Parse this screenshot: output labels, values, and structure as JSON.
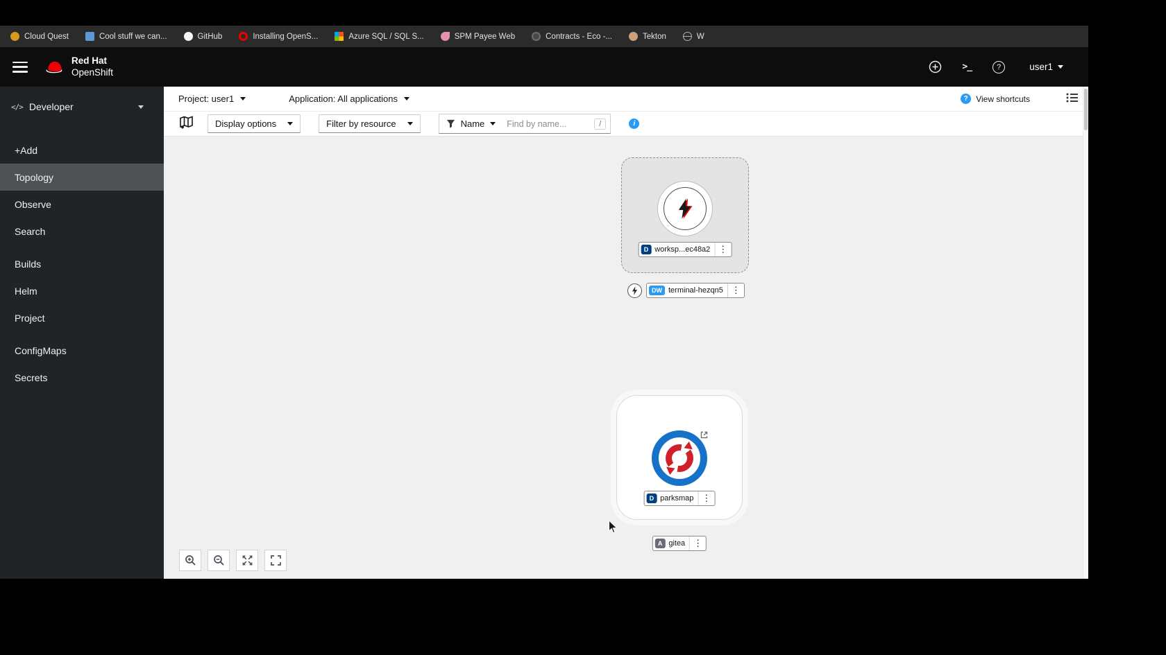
{
  "browser": {
    "bookmarks": [
      {
        "label": "Cloud Quest"
      },
      {
        "label": "Cool stuff we can..."
      },
      {
        "label": "GitHub"
      },
      {
        "label": "Installing OpenS..."
      },
      {
        "label": "Azure SQL / SQL S..."
      },
      {
        "label": "SPM Payee Web"
      },
      {
        "label": "Contracts - Eco -..."
      },
      {
        "label": "Tekton"
      },
      {
        "label": "W"
      }
    ]
  },
  "masthead": {
    "brand_line1": "Red Hat",
    "brand_line2": "OpenShift",
    "username": "user1"
  },
  "sidebar": {
    "perspective": "Developer",
    "items": [
      {
        "label": "+Add"
      },
      {
        "label": "Topology"
      },
      {
        "label": "Observe"
      },
      {
        "label": "Search"
      },
      {
        "label": "Builds"
      },
      {
        "label": "Helm"
      },
      {
        "label": "Project"
      },
      {
        "label": "ConfigMaps"
      },
      {
        "label": "Secrets"
      }
    ]
  },
  "context_bar": {
    "project": "Project: user1",
    "application": "Application: All applications",
    "view_shortcuts": "View shortcuts"
  },
  "toolbar": {
    "display_options": "Display options",
    "filter_by_resource": "Filter by resource",
    "name_filter": "Name",
    "search_placeholder": "Find by name...",
    "shortcut_hint": "/"
  },
  "topology": {
    "workspace": {
      "badge": "D",
      "label": "worksp...ec48a2"
    },
    "terminal": {
      "badge": "DW",
      "label": "terminal-hezqn5"
    },
    "parksmap": {
      "badge": "D",
      "label": "parksmap"
    },
    "gitea": {
      "badge": "A",
      "label": "gitea"
    }
  },
  "colors": {
    "accent_blue": "#2b9af3",
    "deployment_badge": "#004080",
    "devworkspace_badge": "#2b9af3",
    "application_badge": "#6a6e73",
    "brand_red": "#ee0000",
    "parksmap_ring": "#1672c8",
    "parksmap_arrows": "#cf2127"
  }
}
